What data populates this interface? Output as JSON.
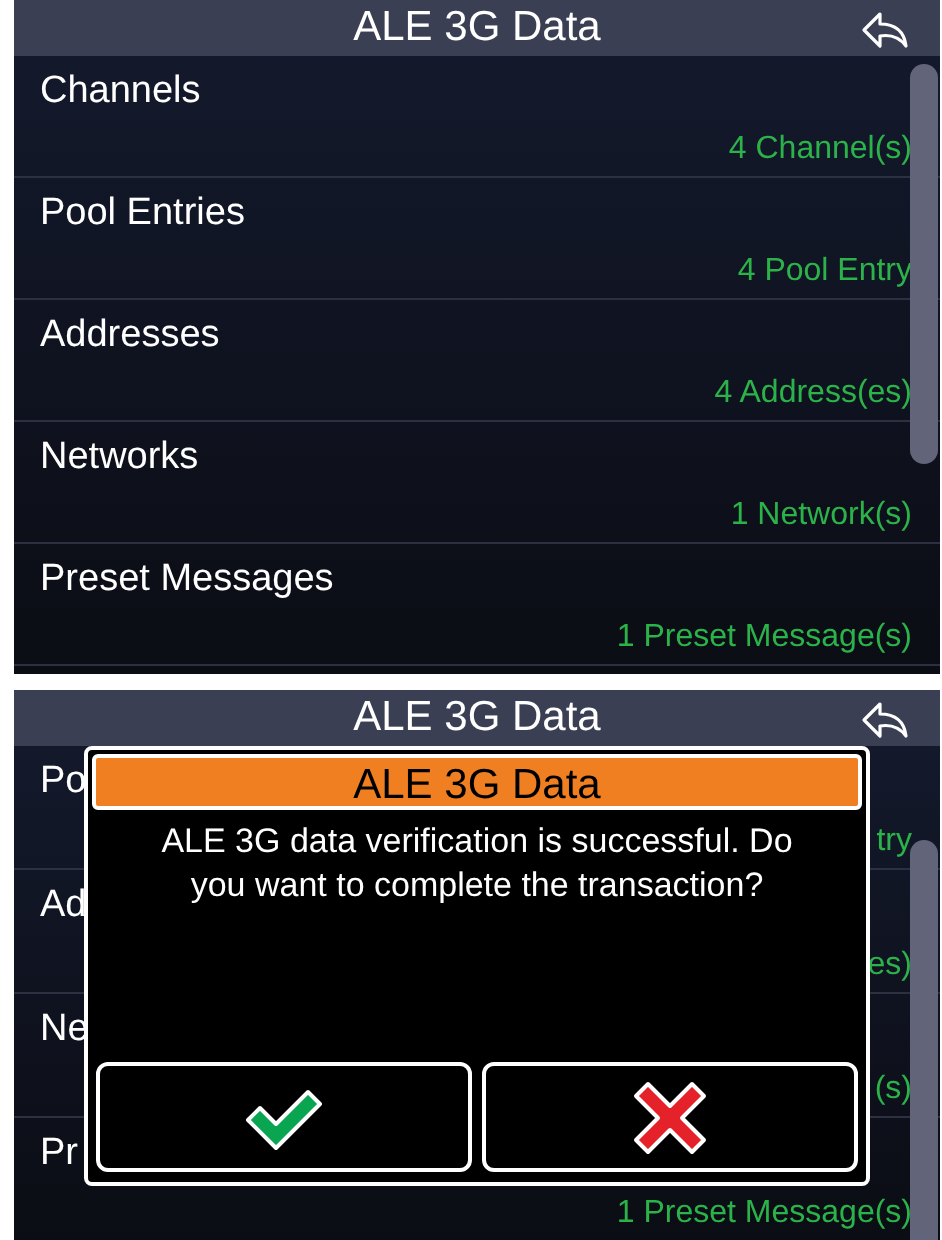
{
  "screens": [
    {
      "title": "ALE 3G Data",
      "items": [
        {
          "label": "Channels",
          "value": "4 Channel(s)"
        },
        {
          "label": "Pool Entries",
          "value": "4 Pool Entry"
        },
        {
          "label": "Addresses",
          "value": "4 Address(es)"
        },
        {
          "label": "Networks",
          "value": "1 Network(s)"
        },
        {
          "label": "Preset Messages",
          "value": "1 Preset Message(s)"
        }
      ]
    },
    {
      "title": "ALE 3G Data",
      "items": [
        {
          "label": "Po",
          "value": "try"
        },
        {
          "label": "Ad",
          "value": "es)"
        },
        {
          "label": "Ne",
          "value": "(s)"
        },
        {
          "label": "Pr",
          "value": "1 Preset Message(s)"
        }
      ],
      "dialog": {
        "title": "ALE 3G Data",
        "message": "ALE 3G data verification is successful. Do you want to complete the transaction?",
        "buttons": [
          {
            "kind": "confirm"
          },
          {
            "kind": "cancel"
          }
        ]
      }
    }
  ]
}
